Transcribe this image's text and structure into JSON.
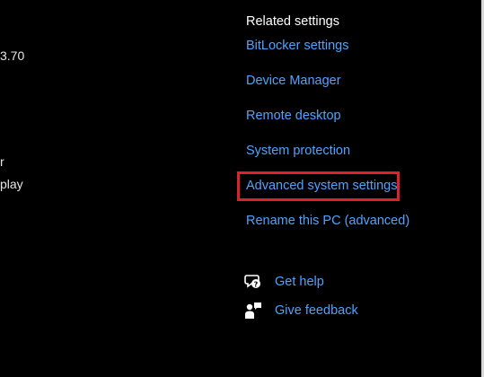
{
  "left_fragments": {
    "version_tail": "3.70",
    "line_r": "r",
    "line_play": "play"
  },
  "related_settings": {
    "heading": "Related settings",
    "links": [
      "BitLocker settings",
      "Device Manager",
      "Remote desktop",
      "System protection",
      "Advanced system settings",
      "Rename this PC (advanced)"
    ],
    "highlighted_link": "Advanced system settings",
    "highlight_color": "#e0202a",
    "link_color": "#4fa3ff"
  },
  "support": {
    "get_help": {
      "label": "Get help",
      "icon": "help-chat-icon"
    },
    "give_feedback": {
      "label": "Give feedback",
      "icon": "feedback-icon"
    }
  }
}
